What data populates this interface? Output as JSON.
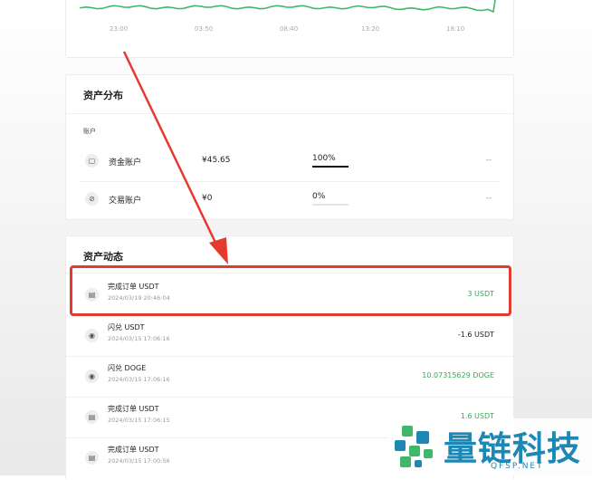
{
  "chart": {
    "times": [
      "23:00",
      "03:50",
      "08:40",
      "13:20",
      "18:10"
    ],
    "line_color": "#3fb86a"
  },
  "allocation": {
    "title": "资产分布",
    "sub_label": "账户",
    "accounts": [
      {
        "name": "资金账户",
        "balance": "¥45.65",
        "percent": "100%",
        "fraction": 1.0,
        "dash": "--",
        "icon": "wallet-icon",
        "glyph": "▢"
      },
      {
        "name": "交易账户",
        "balance": "¥0",
        "percent": "0%",
        "fraction": 0.0,
        "dash": "--",
        "icon": "exchange-icon",
        "glyph": "⊘"
      }
    ]
  },
  "flows": {
    "title": "资产动态",
    "items": [
      {
        "title": "完成订单 USDT",
        "time": "2024/03/19 20:46:04",
        "amount": "3 USDT",
        "color": "#3aa85a",
        "icon": "order-icon",
        "glyph": "▤"
      },
      {
        "title": "闪兑 USDT",
        "time": "2024/03/15 17:06:16",
        "amount": "-1.6 USDT",
        "color": "#222222",
        "icon": "swap-icon",
        "glyph": "◉"
      },
      {
        "title": "闪兑 DOGE",
        "time": "2024/03/15 17:06:16",
        "amount": "10.07315629 DOGE",
        "color": "#3aa85a",
        "icon": "swap-icon",
        "glyph": "◉"
      },
      {
        "title": "完成订单 USDT",
        "time": "2024/03/15 17:06:15",
        "amount": "1.6 USDT",
        "color": "#3aa85a",
        "icon": "order-icon",
        "glyph": "▤"
      },
      {
        "title": "完成订单 USDT",
        "time": "2024/03/15 17:00:56",
        "amount": "",
        "color": "#3aa85a",
        "icon": "order-icon",
        "glyph": "▤"
      }
    ]
  },
  "annotation": {
    "color": "#e53a2e"
  },
  "watermark": {
    "text": "量链科技",
    "url": "QFSP.NET",
    "color": "#1e88b4"
  }
}
